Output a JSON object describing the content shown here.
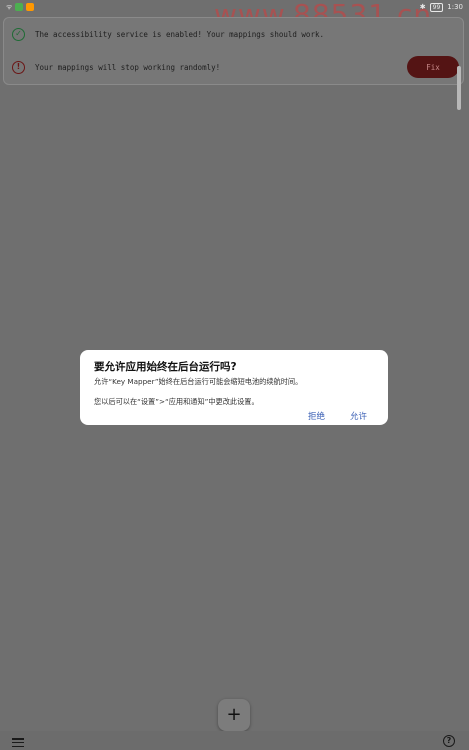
{
  "status_bar": {
    "left_text": "",
    "time": "1:30",
    "battery": "99"
  },
  "watermark": "www.88531.cn",
  "cards": {
    "success_message": "The accessibility service is enabled! Your mappings should work.",
    "warning_message": "Your mappings will stop working randomly!",
    "fix_label": "Fix"
  },
  "dialog": {
    "title": "要允许应用始终在后台运行吗?",
    "message": "允许“Key Mapper”始终在后台运行可能会缩短电池的续航时间。",
    "note": "您以后可以在“设置”>“应用和通知”中更改此设置。",
    "deny_label": "拒绝",
    "allow_label": "允许"
  },
  "fab": {
    "label": "+"
  },
  "icons": {
    "check": "✓",
    "alert": "!",
    "help": "?"
  },
  "colors": {
    "success": "#1f6b35",
    "error": "#6b1616",
    "fix_bg": "#541414",
    "dialog_button": "#3a5fb5"
  }
}
